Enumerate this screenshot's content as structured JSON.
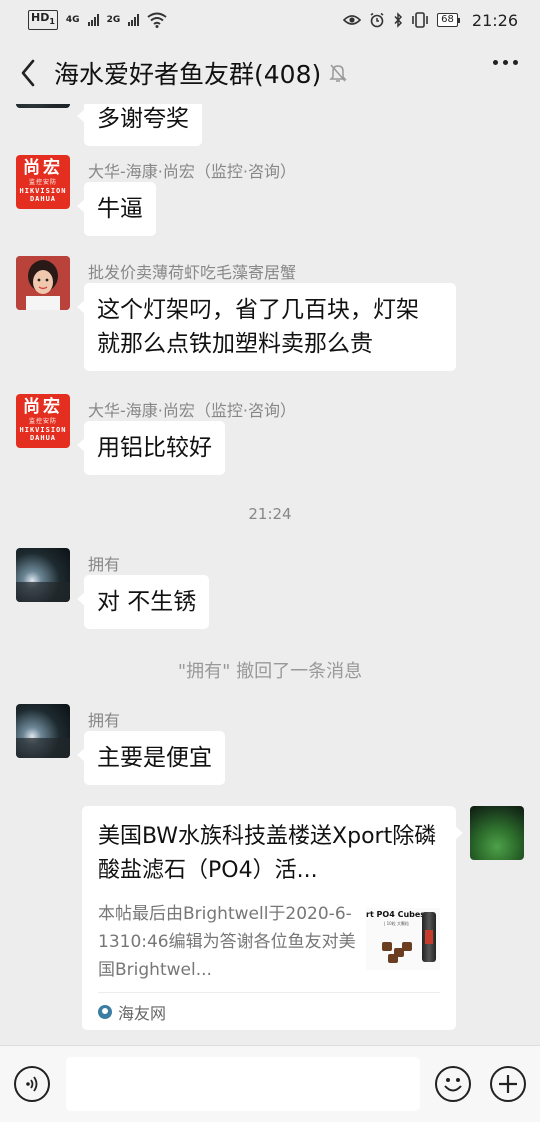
{
  "status_bar": {
    "hd_label": "HD",
    "hd_sub": "1",
    "net1": "4G",
    "net2": "2G",
    "battery": "68",
    "time": "21:26"
  },
  "header": {
    "title": "海水爱好者鱼友群(408)",
    "back_icon": "chevron-left-icon",
    "mute_icon": "bell-off-icon",
    "more_icon": "more-dots-icon"
  },
  "avatar_logo": {
    "big": "尚宏",
    "small": "监控安防",
    "brand1": "HIKVISION",
    "brand2": "DAHUA"
  },
  "messages": [
    {
      "type": "text",
      "text": "多谢夸奖"
    },
    {
      "type": "text",
      "sender": "大华-海康·尚宏（监控·咨询）",
      "text": "牛逼"
    },
    {
      "type": "text",
      "sender": "批发价卖薄荷虾吃毛藻寄居蟹",
      "text_line1": "这个灯架叼，省了几百块，灯架",
      "text_line2": "就那么点铁加塑料卖那么贵"
    },
    {
      "type": "text",
      "sender": "大华-海康·尚宏（监控·咨询）",
      "text": "用铝比较好"
    },
    {
      "type": "time",
      "text": "21:24"
    },
    {
      "type": "text",
      "sender": "拥有",
      "text": "对 不生锈"
    },
    {
      "type": "system",
      "text": "\"拥有\" 撤回了一条消息"
    },
    {
      "type": "text",
      "sender": "拥有",
      "text": "主要是便宜"
    }
  ],
  "link_card": {
    "title": "美国BW水族科技盖楼送Xport除磷酸盐滤石（PO4）活...",
    "description": "本帖最后由Brightwell于2020-6-1310:46编辑为答谢各位鱼友对美国Brightwel...",
    "thumb_text": "rt PO4 Cubes",
    "thumb_sub": "| 10粒 大颗粒",
    "source": "海友网"
  },
  "input_bar": {
    "placeholder": "",
    "voice_icon": "voice-icon",
    "emoji_icon": "emoji-icon",
    "plus_icon": "plus-icon"
  }
}
